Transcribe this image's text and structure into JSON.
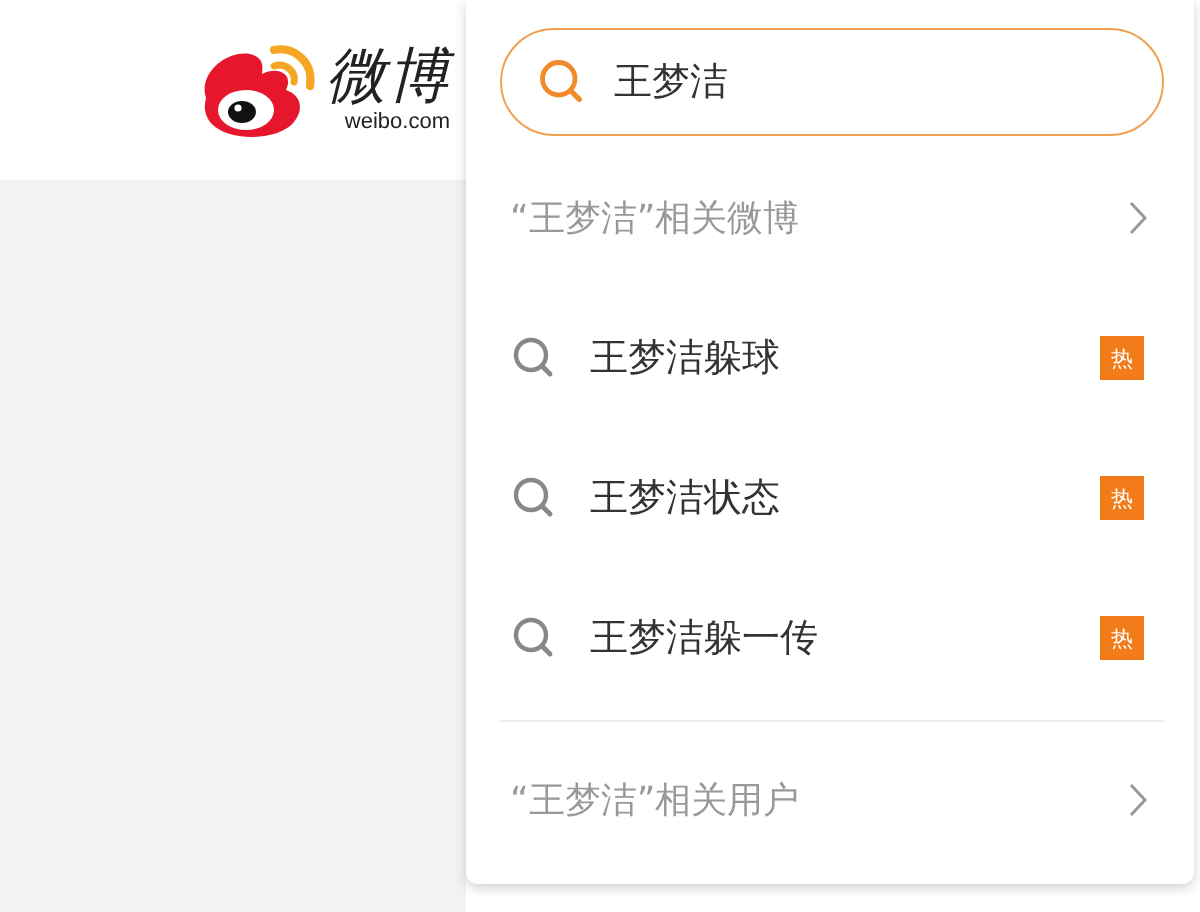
{
  "logo": {
    "name": "微博",
    "domain": "weibo.com"
  },
  "search": {
    "value": "王梦洁"
  },
  "items": [
    {
      "kind": "link",
      "label": "“王梦洁”相关微博"
    },
    {
      "kind": "suggestion",
      "label": "王梦洁躲球",
      "badge": "热"
    },
    {
      "kind": "suggestion",
      "label": "王梦洁状态",
      "badge": "热"
    },
    {
      "kind": "suggestion",
      "label": "王梦洁躲一传",
      "badge": "热"
    },
    {
      "kind": "link",
      "label": "“王梦洁”相关用户"
    }
  ]
}
